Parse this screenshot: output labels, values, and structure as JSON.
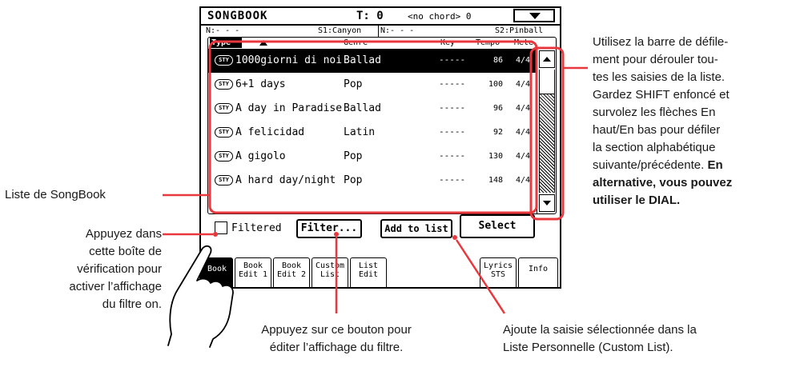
{
  "header": {
    "title": "SONGBOOK",
    "tempo": "T: 0",
    "chord": "<no chord> 0",
    "menu_icon": "chevron-down-icon"
  },
  "info_bar": {
    "left_n": "N:- - -",
    "s1": "S1:Canyon",
    "right_n": "N:- - -",
    "s2": "S2:Pinball"
  },
  "list": {
    "headers": {
      "type": "Type",
      "genre": "Genre",
      "key": "Key",
      "tempo": "Tempo",
      "meter": "Mete"
    },
    "sts_badge": "STY",
    "rows": [
      {
        "name": "1000giorni di noi",
        "genre": "Ballad",
        "key": "-----",
        "tempo": "86",
        "meter": "4/4",
        "selected": true
      },
      {
        "name": "6+1 days",
        "genre": "Pop",
        "key": "-----",
        "tempo": "100",
        "meter": "4/4"
      },
      {
        "name": "A day in Paradise",
        "genre": "Ballad",
        "key": "-----",
        "tempo": "96",
        "meter": "4/4"
      },
      {
        "name": "A felicidad",
        "genre": "Latin",
        "key": "-----",
        "tempo": "92",
        "meter": "4/4"
      },
      {
        "name": "A gigolo",
        "genre": "Pop",
        "key": "-----",
        "tempo": "130",
        "meter": "4/4"
      },
      {
        "name": "A hard day/night",
        "genre": "Pop",
        "key": "-----",
        "tempo": "148",
        "meter": "4/4"
      }
    ]
  },
  "controls": {
    "filtered_label": "Filtered",
    "filter_button": "Filter...",
    "add_button": "Add to list",
    "select_button": "Select"
  },
  "tabs": {
    "book": "Book",
    "book_edit1_a": "Book",
    "book_edit1_b": "Edit 1",
    "book_edit2_a": "Book",
    "book_edit2_b": "Edit 2",
    "custom_list_a": "Custom",
    "custom_list_b": "List",
    "list_edit_a": "List",
    "list_edit_b": "Edit",
    "lyrics_sts_a": "Lyrics",
    "lyrics_sts_b": "STS",
    "info": "Info"
  },
  "callouts": {
    "list_label": "Liste de SongBook",
    "checkbox_help": [
      "Appuyez dans",
      "cette boîte de",
      "vérification pour",
      "activer l’affichage",
      "du filtre on."
    ],
    "filter_help": [
      "Appuyez sur ce bouton pour",
      "éditer l’affichage du filtre."
    ],
    "add_help": [
      "Ajoute la saisie sélectionnée dans la",
      "Liste Personnelle (Custom List)."
    ],
    "scroll_help": [
      "Utilisez la barre de défile-",
      "ment pour dérouler tou-",
      "tes les saisies de la liste.",
      "Gardez SHIFT enfoncé et",
      "survolez les flèches En",
      "haut/En bas pour défiler",
      "la section alphabétique",
      "suivante/précédente."
    ],
    "scroll_help_bold": [
      "En",
      "alternative, vous pouvez",
      "utiliser le DIAL."
    ]
  },
  "colors": {
    "accent": "#e8383d",
    "screen_ink": "#000000"
  }
}
